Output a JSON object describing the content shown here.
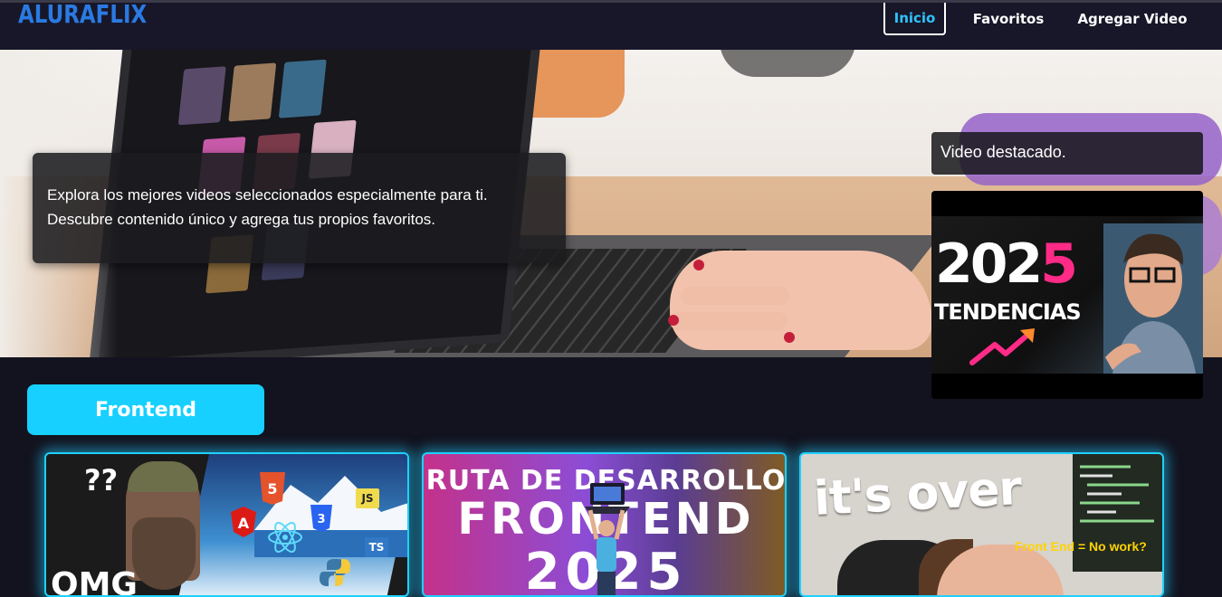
{
  "header": {
    "logo": "ALURAFLIX",
    "nav": [
      {
        "label": "Inicio",
        "active": true
      },
      {
        "label": "Favoritos",
        "active": false
      },
      {
        "label": "Agregar Video",
        "active": false
      }
    ]
  },
  "hero": {
    "intro_line1": "Explora los mejores videos seleccionados especialmente para ti.",
    "intro_line2": "Descubre contenido único y agrega tus propios favoritos.",
    "featured_label": "Video destacado.",
    "featured_thumb": {
      "year_prefix": "202",
      "year_suffix": "5",
      "caption": "TENDENCIAS"
    }
  },
  "category": {
    "title": "Frontend",
    "color": "#17d0ff",
    "videos": [
      {
        "q": "??",
        "badges": [
          "JS",
          "TS"
        ],
        "text": "OMG"
      },
      {
        "line1": "RUTA DE DESARROLLO",
        "line2": "FRONTEND",
        "line3": "2025"
      },
      {
        "title": "it's over",
        "subtitle": "Front End = No work?"
      }
    ]
  },
  "colors": {
    "logo": "#2a7ae2",
    "active_nav": "#2fc2ff",
    "background": "#13131f",
    "accent": "#17d0ff"
  }
}
